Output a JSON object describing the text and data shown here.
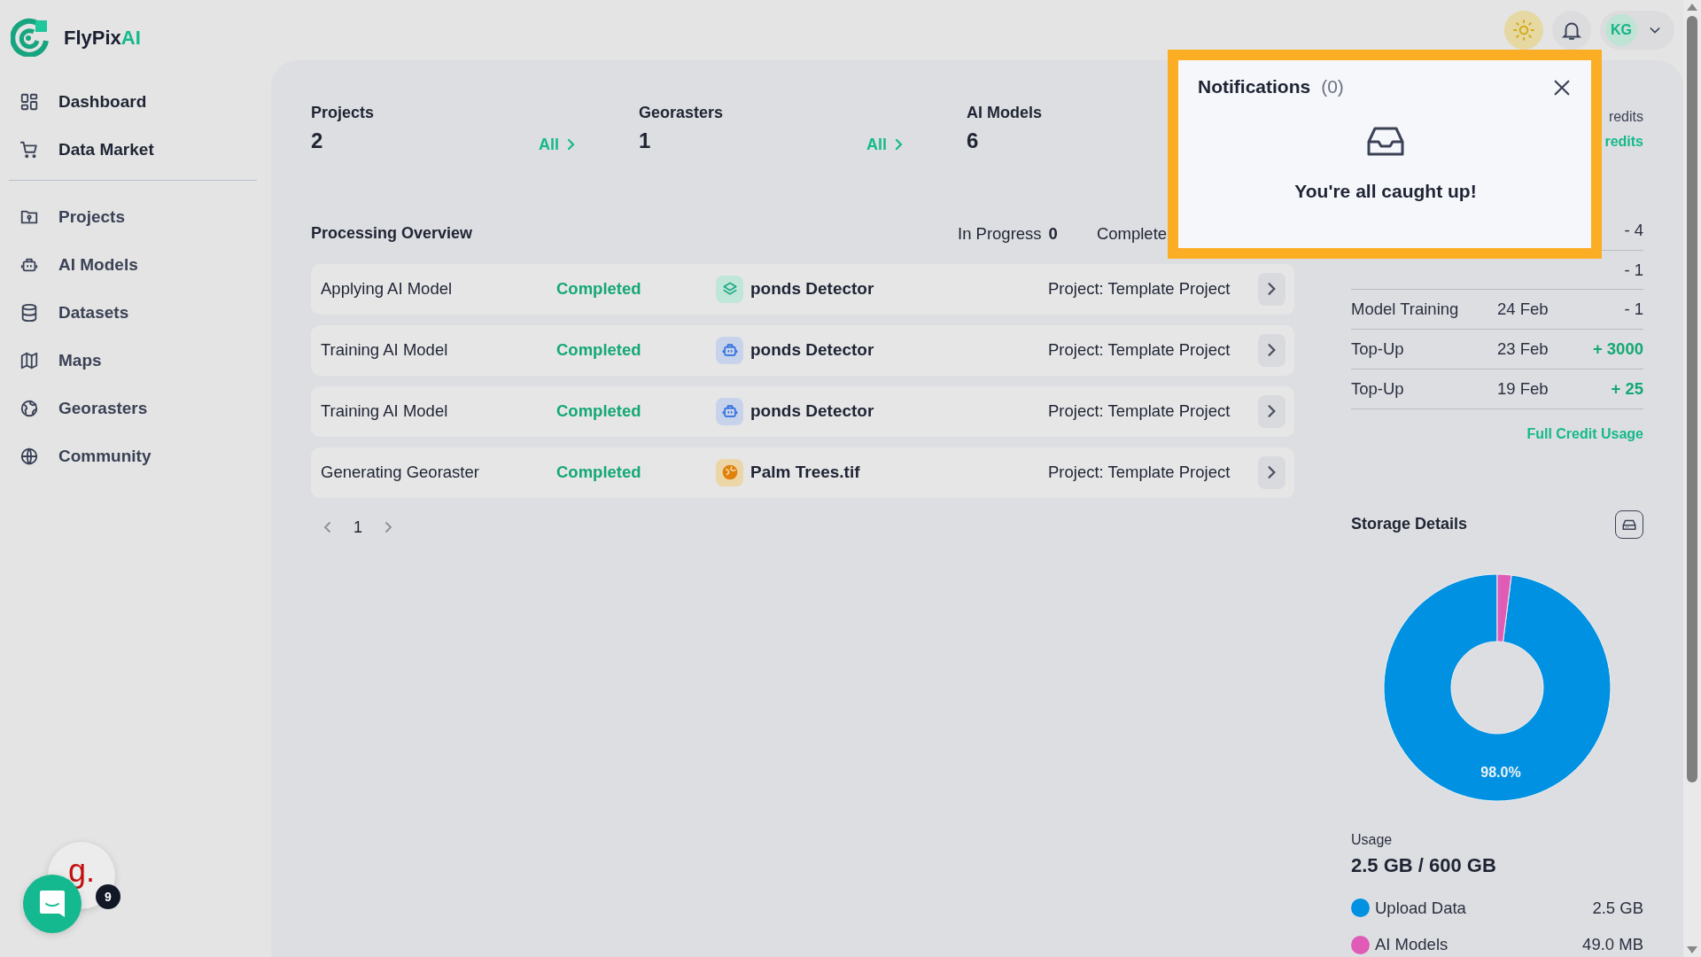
{
  "brand": {
    "name": "FlyPix",
    "accent": "AI"
  },
  "sidebar": {
    "items": [
      {
        "label": "Dashboard"
      },
      {
        "label": "Data Market"
      },
      {
        "label": "Projects"
      },
      {
        "label": "AI Models"
      },
      {
        "label": "Datasets"
      },
      {
        "label": "Maps"
      },
      {
        "label": "Georasters"
      },
      {
        "label": "Community"
      }
    ]
  },
  "header": {
    "user_initials": "KG"
  },
  "stats": [
    {
      "label": "Projects",
      "value": "2",
      "link": "All"
    },
    {
      "label": "Georasters",
      "value": "1",
      "link": "All"
    },
    {
      "label": "AI Models",
      "value": "6"
    }
  ],
  "processing": {
    "title": "Processing Overview",
    "counters": [
      {
        "label": "In Progress",
        "value": "0"
      },
      {
        "label": "Complete"
      }
    ],
    "rows": [
      {
        "task": "Applying AI Model",
        "status": "Completed",
        "kind": "layers",
        "name": "ponds Detector",
        "project": "Project: Template Project"
      },
      {
        "task": "Training AI Model",
        "status": "Completed",
        "kind": "robot",
        "name": "ponds Detector",
        "project": "Project: Template Project"
      },
      {
        "task": "Training AI Model",
        "status": "Completed",
        "kind": "robot",
        "name": "ponds Detector",
        "project": "Project: Template Project"
      },
      {
        "task": "Generating Georaster",
        "status": "Completed",
        "kind": "globe",
        "name": "Palm Trees.tif",
        "project": "Project: Template Project"
      }
    ],
    "pagination": {
      "page": "1"
    }
  },
  "credits": {
    "header_texts": [
      {
        "text": "redits",
        "kind": "label"
      },
      {
        "text": "redits",
        "kind": "link"
      }
    ],
    "rows": [
      {
        "amount": "- 4",
        "kind": "debit"
      },
      {
        "amount": "- 1",
        "kind": "debit"
      },
      {
        "label": "Model Training",
        "date": "24 Feb",
        "amount": "- 1",
        "kind": "debit"
      },
      {
        "label": "Top-Up",
        "date": "23 Feb",
        "amount": "+ 3000",
        "kind": "topup"
      },
      {
        "label": "Top-Up",
        "date": "19 Feb",
        "amount": "+ 25",
        "kind": "topup"
      }
    ],
    "link": "Full Credit Usage"
  },
  "storage": {
    "title": "Storage Details",
    "chart_data": {
      "type": "donut",
      "values": [
        98.0,
        2.0
      ],
      "value_labels": [
        "98.0%",
        null
      ]
    },
    "usage_label": "Usage",
    "usage": "2.5 GB / 600 GB",
    "legend": [
      {
        "label": "Upload Data",
        "value": "2.5 GB",
        "color": "#0091e2"
      },
      {
        "label": "AI Models",
        "value": "49.0 MB",
        "color": "#e05bb6"
      }
    ]
  },
  "notifications": {
    "title": "Notifications",
    "count": "(0)",
    "empty_text": "You're all caught up!"
  },
  "widgets": {
    "logo_text": "g.",
    "badge": "9"
  }
}
